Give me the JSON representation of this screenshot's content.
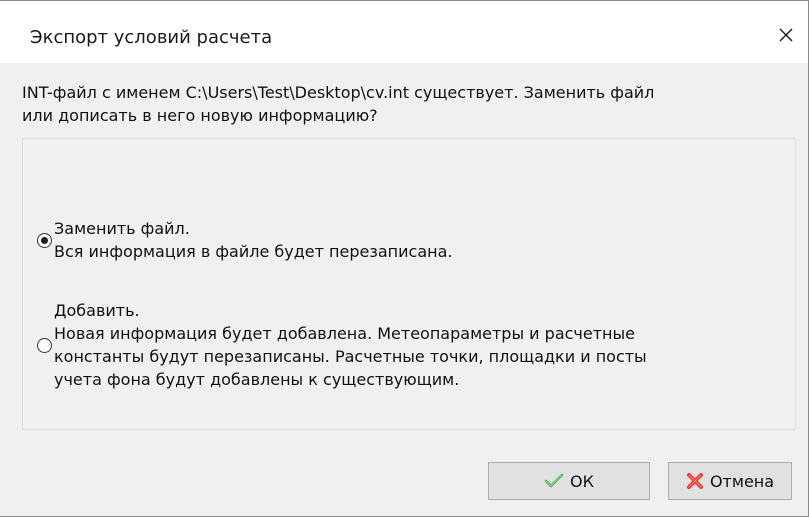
{
  "dialog": {
    "title": "Экспорт условий расчета",
    "close_icon": "close-icon",
    "message_line1": "INT-файл с именем C:\\Users\\Test\\Desktop\\cv.int существует. Заменить файл",
    "message_line2": "или дописать в него новую информацию?"
  },
  "options": [
    {
      "selected": true,
      "lines": [
        "Заменить файл.",
        "Вся информация в файле будет перезаписана."
      ]
    },
    {
      "selected": false,
      "lines": [
        "Добавить.",
        "Новая информация будет добавлена. Метеопараметры и расчетные",
        "константы будут перезаписаны. Расчетные точки, площадки и посты",
        "учета фона будут добавлены к существующим."
      ]
    }
  ],
  "buttons": {
    "ok_label": "ОК",
    "ok_icon": "checkmark-icon",
    "ok_icon_color": "#4caf50",
    "cancel_label": "Отмена",
    "cancel_icon": "cross-icon",
    "cancel_icon_color": "#e53935"
  }
}
